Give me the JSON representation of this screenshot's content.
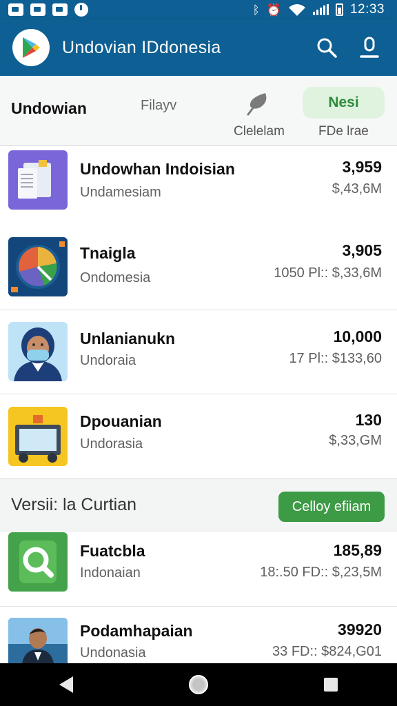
{
  "status_bar": {
    "time": "12:33",
    "icons": [
      "image-icon",
      "message-icon",
      "facebook-icon",
      "clock-icon",
      "bluetooth-icon",
      "alarm-icon",
      "wifi-icon",
      "signal-icon",
      "battery-icon"
    ]
  },
  "app_bar": {
    "title": "Undovian IDdonesia",
    "color": "#0e5f93",
    "icons": [
      "play-store-logo-icon",
      "search-icon",
      "user-icon"
    ]
  },
  "filter_bar": {
    "title": "Undowian",
    "chip": "Filayv",
    "sub_label_1": "Clelelam",
    "sub_label_2": "FDe lrae",
    "new_chip": "Nesi"
  },
  "list_items": [
    {
      "title": "Undowhan Indoisian",
      "subtitle": "Undamesiam",
      "number": "3,959",
      "price": "$,43,6M",
      "thumb": "document-icon"
    },
    {
      "title": "Tnaigla",
      "subtitle": "Ondomesia",
      "number": "3,905",
      "price": "1050 Pl:: $,33,6M",
      "thumb": "chart-gear-icon"
    },
    {
      "title": "Unlanianukn",
      "subtitle": "Undoraia",
      "number": "10,000",
      "price": "17 Pl:: $133,60",
      "thumb": "person-icon"
    },
    {
      "title": "Dpouanian",
      "subtitle": "Undorasia",
      "number": "130",
      "price": "$,33,GM",
      "thumb": "cart-icon"
    }
  ],
  "section": {
    "title": "Versii: la Curtian",
    "button": "Celloy efiiam",
    "accent": "#3d9a45"
  },
  "section_items": [
    {
      "title": "Fuatcbla",
      "subtitle": "Indonaian",
      "number": "185,89",
      "price": "18:.50 FD:: $,23,5M",
      "thumb": "search-icon"
    },
    {
      "title": "Podamhapaian",
      "subtitle": "Undonasia",
      "number": "39920",
      "price": "33 FD:: $824,G01",
      "thumb": "person-photo-icon"
    }
  ],
  "nav_bar": {
    "icons": [
      "back-icon",
      "home-icon",
      "recents-icon"
    ]
  }
}
